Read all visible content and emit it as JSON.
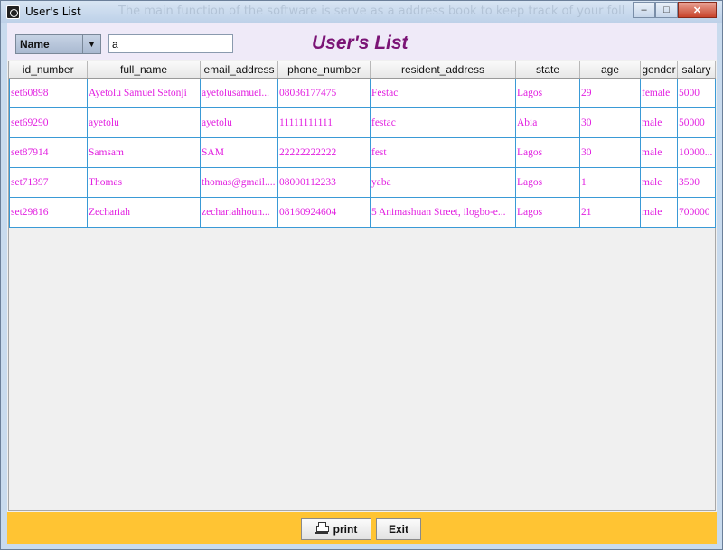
{
  "window": {
    "title": "User's List",
    "background_text": "The main function of the software is serve as a address book to keep track of your folks"
  },
  "toolbar": {
    "search_field_selected": "Name",
    "search_value": "a",
    "heading": "User's List"
  },
  "table": {
    "columns": [
      "id_number",
      "full_name",
      "email_address",
      "phone_number",
      "resident_address",
      "state",
      "age",
      "gender",
      "salary"
    ],
    "rows": [
      [
        "set60898",
        "Ayetolu Samuel Setonji",
        "ayetolusamuel...",
        "08036177475",
        "Festac",
        "Lagos",
        "29",
        "female",
        "5000"
      ],
      [
        "set69290",
        "ayetolu",
        "ayetolu",
        "11111111111",
        "festac",
        "Abia",
        "30",
        "male",
        "50000"
      ],
      [
        "set87914",
        "Samsam",
        "SAM",
        "22222222222",
        "fest",
        "Lagos",
        "30",
        "male",
        "10000..."
      ],
      [
        "set71397",
        "Thomas",
        "thomas@gmail....",
        "08000112233",
        "yaba",
        "Lagos",
        "1",
        "male",
        "3500"
      ],
      [
        "set29816",
        "Zechariah",
        "zechariahhoun...",
        "08160924604",
        "5 Animashuan Street, ilogbo-e...",
        "Lagos",
        "21",
        "male",
        "700000"
      ]
    ]
  },
  "buttons": {
    "print": "print",
    "exit": "Exit"
  },
  "colors": {
    "accent_title": "#7b1476",
    "cell_text": "#e21fe0",
    "cell_border": "#3a9ad6",
    "bottom_bar": "#ffc433",
    "toolbar_bg": "#efeaf8"
  }
}
